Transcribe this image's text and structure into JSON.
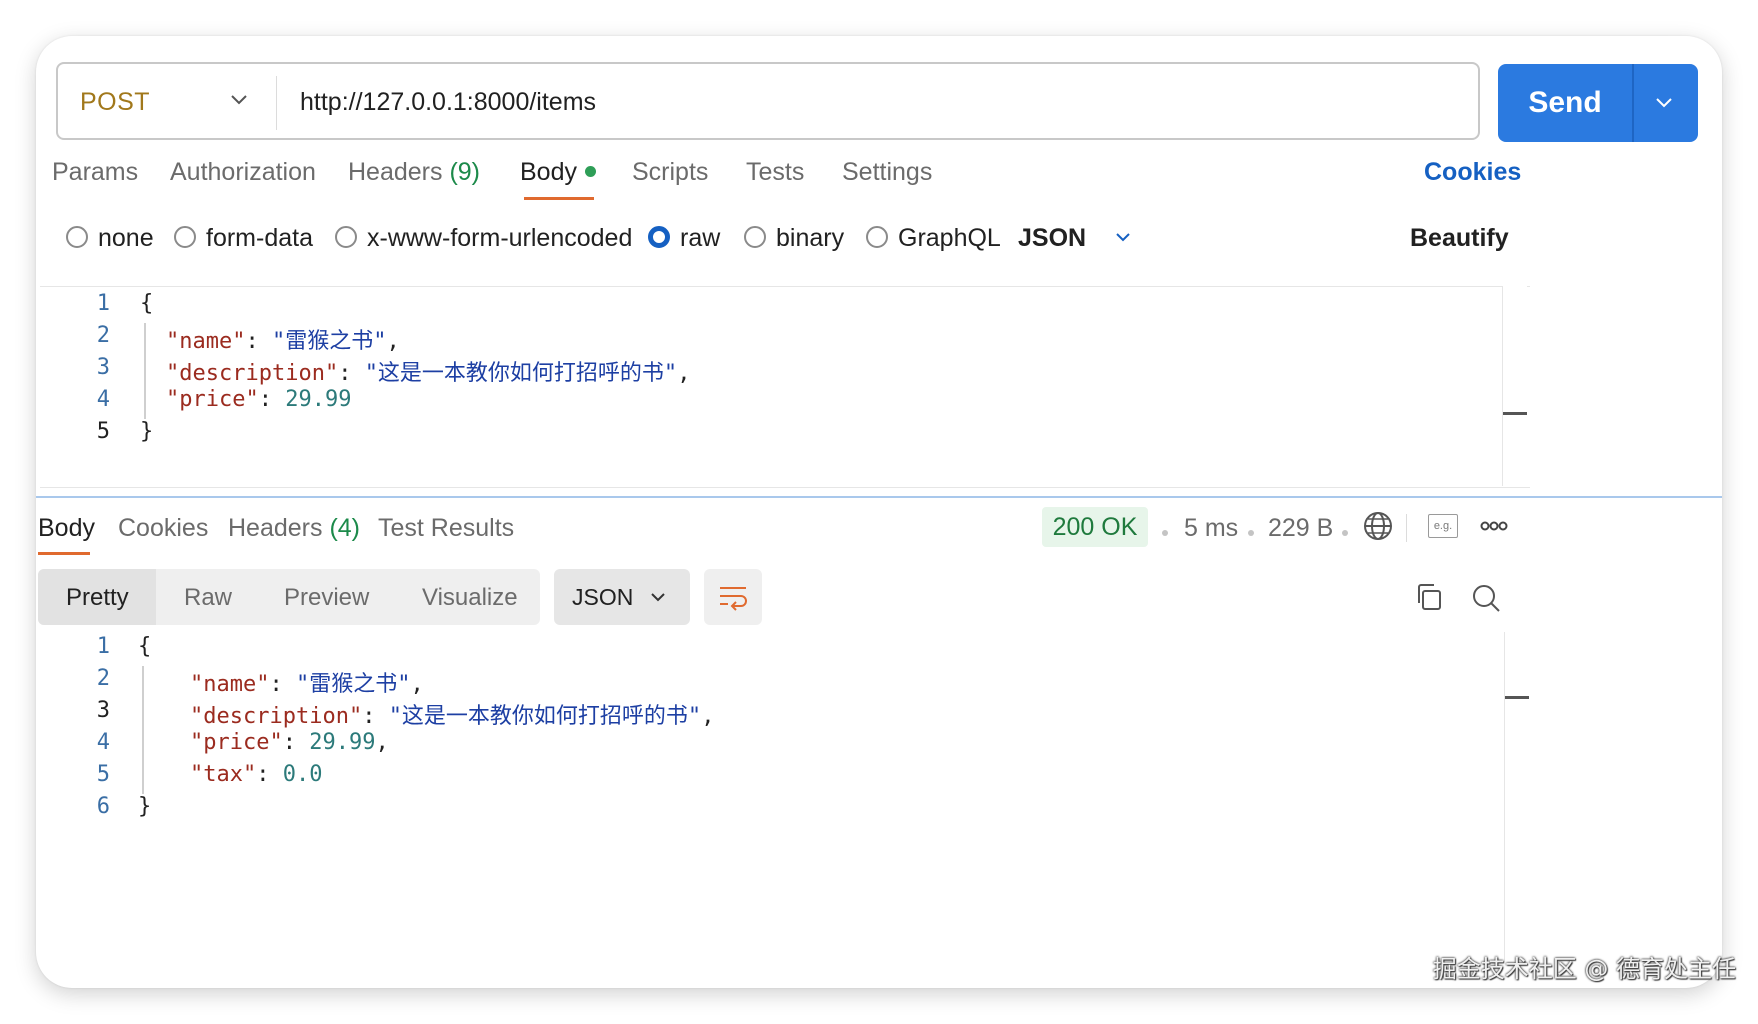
{
  "request": {
    "method": "POST",
    "url": "http://127.0.0.1:8000/items",
    "send_label": "Send",
    "tabs": [
      {
        "label": "Params"
      },
      {
        "label": "Authorization"
      },
      {
        "label": "Headers",
        "count": "(9)"
      },
      {
        "label": "Body",
        "active": true
      },
      {
        "label": "Scripts"
      },
      {
        "label": "Tests"
      },
      {
        "label": "Settings"
      }
    ],
    "cookies_link": "Cookies",
    "body_types": [
      "none",
      "form-data",
      "x-www-form-urlencoded",
      "raw",
      "binary",
      "GraphQL"
    ],
    "selected_body_type": "raw",
    "format": "JSON",
    "beautify": "Beautify",
    "code": {
      "line_numbers": [
        "1",
        "2",
        "3",
        "4",
        "5"
      ],
      "open_brace": "{",
      "close_brace": "}",
      "name_key": "\"name\"",
      "name_value": "\"雷猴之书\"",
      "description_key": "\"description\"",
      "description_value": "\"这是一本教你如何打招呼的书\"",
      "price_key": "\"price\"",
      "price_value": "29.99"
    }
  },
  "response": {
    "tabs": [
      {
        "label": "Body",
        "active": true
      },
      {
        "label": "Cookies"
      },
      {
        "label": "Headers",
        "count": "(4)"
      },
      {
        "label": "Test Results"
      }
    ],
    "status": "200 OK",
    "time": "5 ms",
    "size": "229 B",
    "view_modes": [
      "Pretty",
      "Raw",
      "Preview",
      "Visualize"
    ],
    "active_view": "Pretty",
    "format": "JSON",
    "code": {
      "line_numbers": [
        "1",
        "2",
        "3",
        "4",
        "5",
        "6"
      ],
      "open_brace": "{",
      "close_brace": "}",
      "name_key": "\"name\"",
      "name_value": "\"雷猴之书\"",
      "description_key": "\"description\"",
      "description_value": "\"这是一本教你如何打招呼的书\"",
      "price_key": "\"price\"",
      "price_value": "29.99",
      "tax_key": "\"tax\"",
      "tax_value": "0.0"
    },
    "eg_icon_text": "e.g."
  },
  "watermark": "掘金技术社区 @ 德育处主任",
  "colors": {
    "send": "#2b7ae0",
    "method": "#a1781b",
    "accent_underline": "#e06a2f",
    "status_bg": "#e7f5ea",
    "status_text": "#1f7a3d",
    "json_key": "#9b2b1f",
    "json_string": "#1d3fa3",
    "json_number": "#2c7a7a",
    "link": "#1560c2"
  }
}
